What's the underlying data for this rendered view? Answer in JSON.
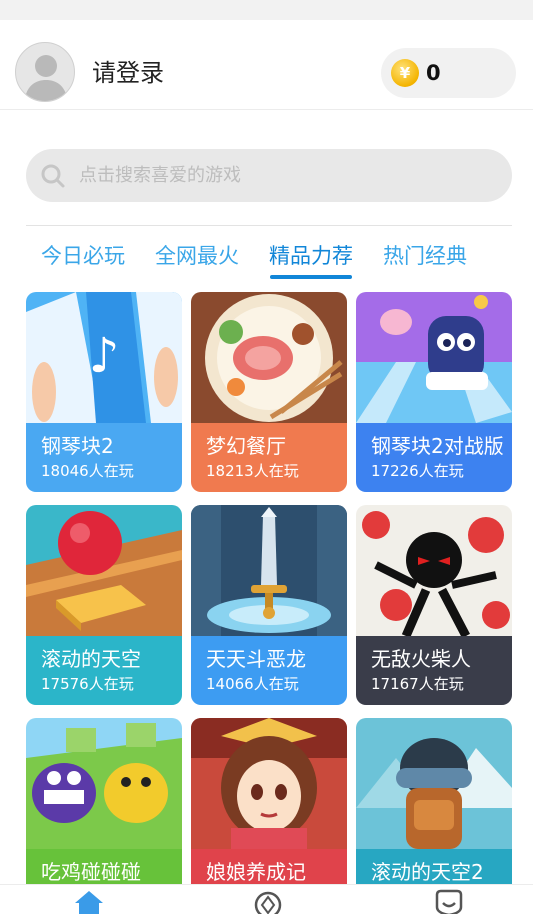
{
  "header": {
    "login_label": "请登录",
    "coins": "0",
    "coin_symbol": "¥"
  },
  "search": {
    "placeholder": "点击搜索喜爱的游戏"
  },
  "tabs": [
    {
      "label": "今日必玩"
    },
    {
      "label": "全网最火"
    },
    {
      "label": "精品力荐",
      "active": true
    },
    {
      "label": "热门经典"
    }
  ],
  "games": [
    {
      "name": "钢琴块2",
      "players": "18046人在玩",
      "color": "#4aa8f2"
    },
    {
      "name": "梦幻餐厅",
      "players": "18213人在玩",
      "color": "#f07a4f"
    },
    {
      "name": "钢琴块2对战版",
      "players": "17226人在玩",
      "color": "#3d82f0"
    },
    {
      "name": "滚动的天空",
      "players": "17576人在玩",
      "color": "#2bb5c9"
    },
    {
      "name": "天天斗恶龙",
      "players": "14066人在玩",
      "color": "#3d9cf2"
    },
    {
      "name": "无敌火柴人",
      "players": "17167人在玩",
      "color": "#3a3d4a"
    },
    {
      "name": "吃鸡碰碰碰",
      "players": "",
      "color": "#67c23a"
    },
    {
      "name": "娘娘养成记",
      "players": "",
      "color": "#e0434b"
    },
    {
      "name": "滚动的天空2",
      "players": "",
      "color": "#27a7c2"
    }
  ],
  "colors": {
    "accent": "#1186d8",
    "tab": "#3aa6e8"
  },
  "bottom_nav": [
    {
      "icon": "home-icon"
    },
    {
      "icon": "discover-icon"
    },
    {
      "icon": "message-icon"
    }
  ]
}
